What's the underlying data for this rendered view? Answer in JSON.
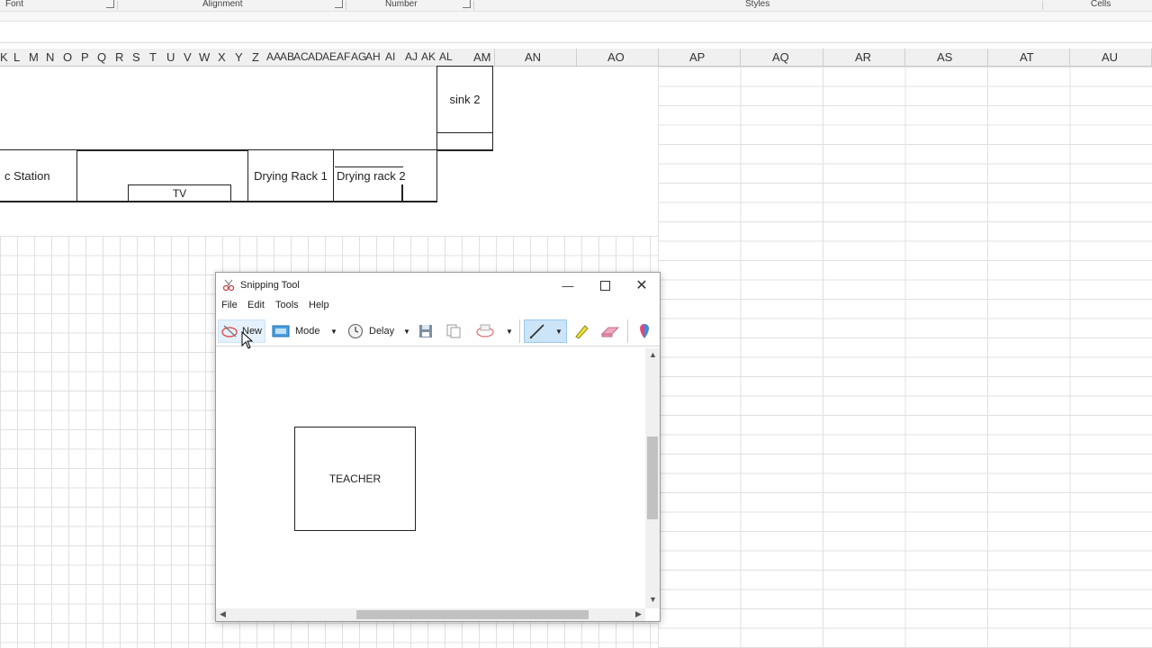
{
  "ribbon": {
    "groups": [
      "Font",
      "Alignment",
      "Number",
      "Styles",
      "Cells"
    ]
  },
  "columns": {
    "narrow": [
      "K",
      "L",
      "M",
      "N",
      "O",
      "P",
      "Q",
      "R",
      "S",
      "T",
      "U",
      "V",
      "W",
      "X",
      "Y",
      "Z",
      "AA",
      "AB",
      "AC",
      "AD",
      "AE",
      "AF",
      "AG",
      "AH",
      "AI",
      "AJ",
      "AK",
      "AL",
      "AM"
    ],
    "wide": [
      "AN",
      "AO",
      "AP",
      "AQ",
      "AR",
      "AS",
      "AT",
      "AU"
    ]
  },
  "sheet_shapes": {
    "sink": "sink 2",
    "station": "c Station",
    "tv": "TV",
    "rack1": "Drying Rack 1",
    "rack2": "Drying rack 2"
  },
  "snipping_tool": {
    "title": "Snipping Tool",
    "menu": [
      "File",
      "Edit",
      "Tools",
      "Help"
    ],
    "toolbar": {
      "new_label": "New",
      "mode_label": "Mode",
      "delay_label": "Delay"
    },
    "canvas_shape": "TEACHER",
    "accent": "#cce4f7"
  }
}
